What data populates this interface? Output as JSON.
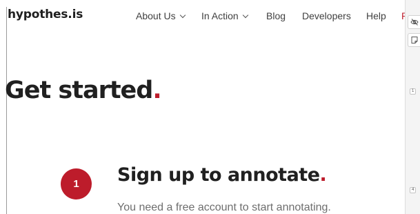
{
  "header": {
    "logo": "hypothes.is",
    "nav": [
      {
        "label": "About Us",
        "has_dropdown": true
      },
      {
        "label": "In Action",
        "has_dropdown": true
      },
      {
        "label": "Blog",
        "has_dropdown": false
      },
      {
        "label": "Developers",
        "has_dropdown": false
      },
      {
        "label": "Help",
        "has_dropdown": false
      }
    ],
    "nav_cut_fragment": "P"
  },
  "hero": {
    "title": "Get started",
    "title_dot": "."
  },
  "step1": {
    "number": "1",
    "title": "Sign up to annotate",
    "title_dot": ".",
    "description": "You need a free account to start annotating."
  },
  "annotation_sidebar": {
    "buttons": [
      {
        "icon": "eye-slash-icon"
      },
      {
        "icon": "note-icon"
      }
    ],
    "bucket_counts": [
      "1",
      "4"
    ]
  },
  "colors": {
    "accent": "#bd1c2b",
    "text": "#202020",
    "muted": "#6e6e6e"
  }
}
